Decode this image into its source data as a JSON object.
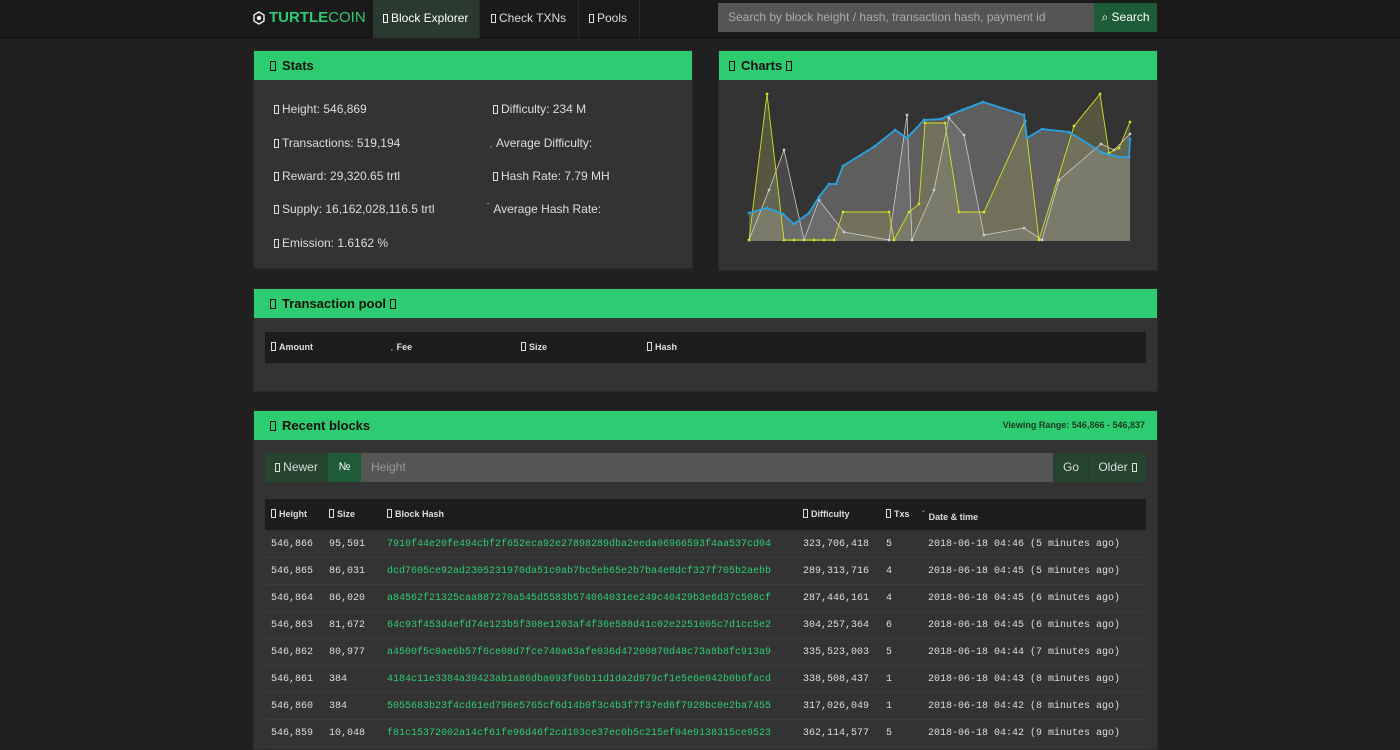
{
  "brand": {
    "part1": "TURTLE",
    "part2": "COIN"
  },
  "nav": {
    "block_explorer": "Block Explorer",
    "check_txns": "Check TXNs",
    "pools": "Pools"
  },
  "search": {
    "placeholder": "Search by block height / hash, transaction hash, payment id",
    "button": "Search"
  },
  "stats": {
    "title": "Stats",
    "height": "Height: 546,869",
    "transactions": "Transactions: 519,194",
    "reward": "Reward: 29,320.65 trtl",
    "supply": "Supply: 16,162,028,116.5 trtl",
    "emission": "Emission: 1.6162 %",
    "difficulty": "Difficulty: 234 M",
    "avg_difficulty": "Average Difficulty:",
    "hash_rate": "Hash Rate: 7.79 MH",
    "avg_hash_rate": "Average Hash Rate:"
  },
  "charts": {
    "title": "Charts",
    "blue": "#29a3e0",
    "yellow": "#d4e020"
  },
  "pool": {
    "title": "Transaction pool",
    "cols": {
      "amount": "Amount",
      "fee": "Fee",
      "size": "Size",
      "hash": "Hash"
    }
  },
  "recent": {
    "title": "Recent blocks",
    "viewing_range": "Viewing Range: 546,866 - 546,837",
    "newer": "Newer",
    "num": "№",
    "height_placeholder": "Height",
    "go": "Go",
    "older": "Older",
    "cols": {
      "height": "Height",
      "size": "Size",
      "hash": "Block Hash",
      "difficulty": "Difficulty",
      "txs": "Txs",
      "date": "Date & time"
    },
    "rows": [
      {
        "height": "546,866",
        "size": "95,591",
        "hash": "7910f44e20fe494cbf2f652eca92e27898289dba2eeda06966593f4aa537cd04",
        "difficulty": "323,706,418",
        "txs": "5",
        "date": "2018-06-18 04:46 (5 minutes ago)"
      },
      {
        "height": "546,865",
        "size": "86,031",
        "hash": "dcd7605ce92ad2305231970da51c0ab7bc5eb65e2b7ba4e8dcf327f705b2aebb",
        "difficulty": "289,313,716",
        "txs": "4",
        "date": "2018-06-18 04:45 (5 minutes ago)"
      },
      {
        "height": "546,864",
        "size": "86,020",
        "hash": "a84562f21325caa887270a545d5583b574064031ee249c40429b3e6d37c508cf",
        "difficulty": "287,446,161",
        "txs": "4",
        "date": "2018-06-18 04:45 (6 minutes ago)"
      },
      {
        "height": "546,863",
        "size": "81,672",
        "hash": "64c93f453d4efd74e123b5f308e1203af4f36e588d41c02e2251005c7d1cc5e2",
        "difficulty": "304,257,364",
        "txs": "6",
        "date": "2018-06-18 04:45 (6 minutes ago)"
      },
      {
        "height": "546,862",
        "size": "80,977",
        "hash": "a4500f5c0ae6b57f6ce08d7fce740a63afe036d47200870d48c73a8b8fc913a9",
        "difficulty": "335,523,003",
        "txs": "5",
        "date": "2018-06-18 04:44 (7 minutes ago)"
      },
      {
        "height": "546,861",
        "size": "384",
        "hash": "4184c11e3384a39423ab1a86dba093f96b11d1da2d979cf1e5e6e042b0b6facd",
        "difficulty": "338,508,437",
        "txs": "1",
        "date": "2018-06-18 04:43 (8 minutes ago)"
      },
      {
        "height": "546,860",
        "size": "384",
        "hash": "5055683b23f4cd61ed796e5765cf6d14b0f3c4b3f7f37ed6f7928bc0e2ba7455",
        "difficulty": "317,026,049",
        "txs": "1",
        "date": "2018-06-18 04:42 (8 minutes ago)"
      },
      {
        "height": "546,859",
        "size": "10,048",
        "hash": "f81c15372002a14cf61fe96d46f2cd103ce37ec0b5c215ef04e9138315ce9523",
        "difficulty": "362,114,577",
        "txs": "5",
        "date": "2018-06-18 04:42 (9 minutes ago)"
      }
    ]
  }
}
